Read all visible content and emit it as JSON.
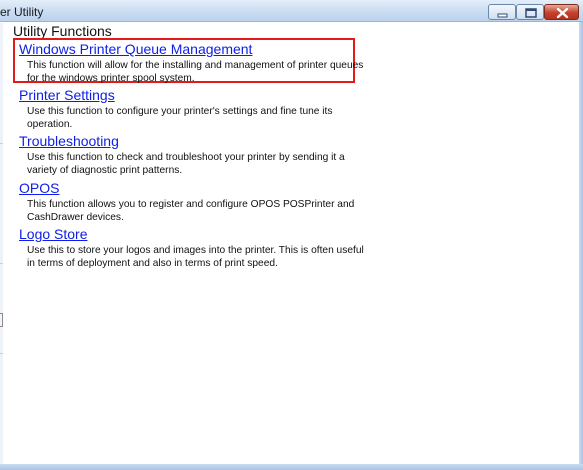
{
  "window": {
    "title": "er Utility",
    "controls": {
      "minimize_icon": "minimize-icon",
      "maximize_icon": "maximize-icon",
      "close_icon": "close-icon"
    }
  },
  "main": {
    "section_title": "Utility Functions",
    "items": [
      {
        "label": "Windows Printer Queue Management",
        "description": "This function will allow for the installing and management of printer queues for the windows printer spool system."
      },
      {
        "label": "Printer Settings",
        "description": "Use this function to configure your printer's settings and fine tune its operation."
      },
      {
        "label": "Troubleshooting",
        "description": "Use this function to check and troubleshoot your printer by sending it a variety of diagnostic print patterns."
      },
      {
        "label": "OPOS",
        "description": "This function allows you to register and configure OPOS POSPrinter and CashDrawer devices."
      },
      {
        "label": "Logo Store",
        "description": "Use this to store your logos and images into the printer. This is often useful in terms of deployment and also in terms of print speed."
      }
    ]
  },
  "colors": {
    "link": "#0c1ee8",
    "highlight_border": "#e21a1a",
    "title_bar": "#c9dcf1"
  }
}
